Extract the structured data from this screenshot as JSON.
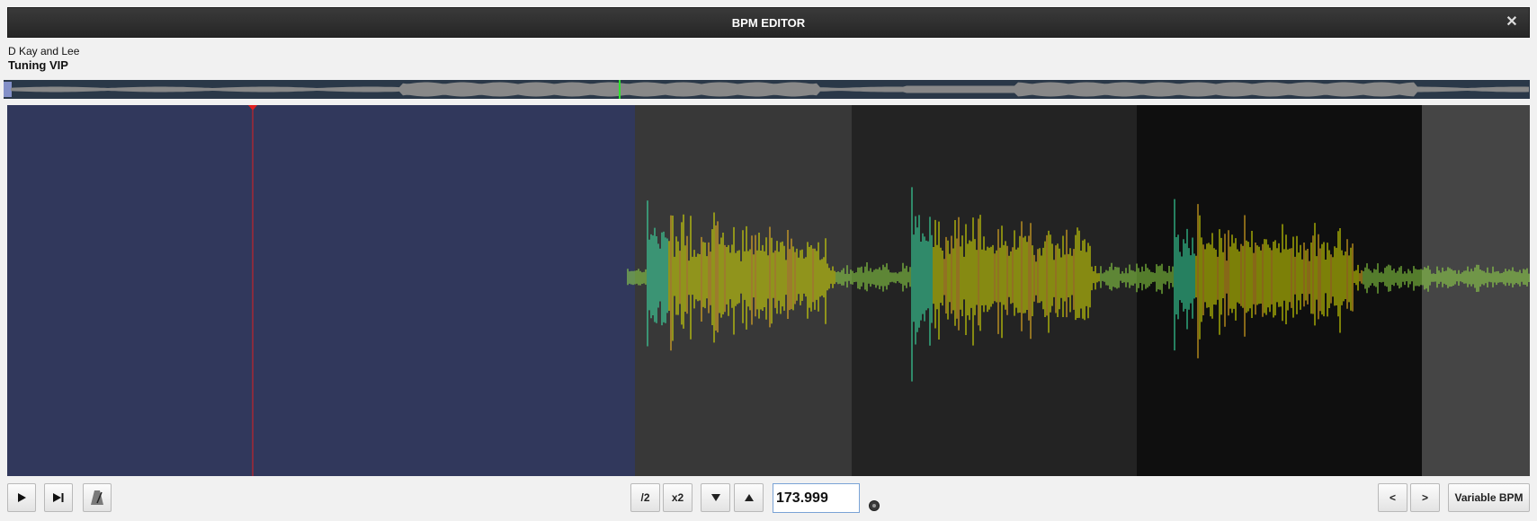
{
  "window": {
    "title": "BPM EDITOR",
    "close_glyph": "✕"
  },
  "track": {
    "artist": "D Kay and Lee",
    "title": "Tuning VIP"
  },
  "overview": {
    "playhead_fraction": 0.4
  },
  "waveform": {
    "colors": {
      "selected_region": "#31385c",
      "cursor": "#e02020",
      "wave_peak": "#e8f000",
      "wave_transient": "#3ef0b0"
    },
    "selected_region_fraction": 0.4125,
    "cursor_fraction": 0.161
  },
  "controls": {
    "play_icon": "play-icon",
    "skip_icon": "skip-to-end-icon",
    "metronome_icon": "metronome-icon",
    "half_label": "/2",
    "double_label": "x2",
    "down_icon": "triangle-down-icon",
    "up_icon": "triangle-up-icon",
    "bpm_value": "173.999",
    "prev_label": "<",
    "next_label": ">",
    "variable_bpm_label": "Variable BPM"
  }
}
